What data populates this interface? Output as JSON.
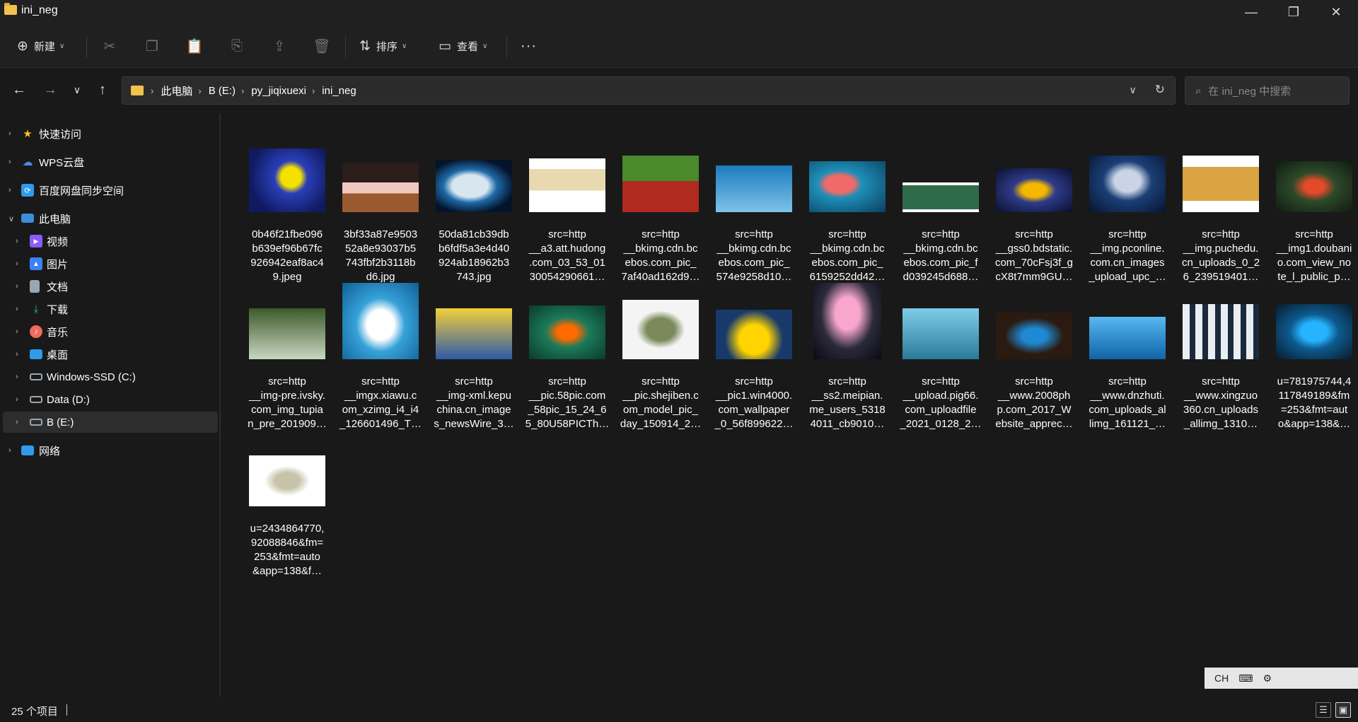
{
  "window": {
    "title": "ini_neg",
    "min": "—",
    "max": "❐",
    "close": "✕"
  },
  "toolbar": {
    "new_label": "新建",
    "sort_label": "排序",
    "view_label": "查看",
    "more_label": "···"
  },
  "breadcrumb": [
    "此电脑",
    "B (E:)",
    "py_jiqixuexi",
    "ini_neg"
  ],
  "search": {
    "placeholder": "在 ini_neg 中搜索"
  },
  "sidebar": {
    "items": [
      {
        "label": "快速访问",
        "icon": "star-icon",
        "color": "#f5c518"
      },
      {
        "label": "WPS云盘",
        "icon": "cloud-icon",
        "color": "#4a8fe7"
      },
      {
        "label": "百度网盘同步空间",
        "icon": "sync-icon",
        "color": "#2f9bea"
      },
      {
        "label": "此电脑",
        "icon": "computer-icon",
        "color": "#3b8edb"
      },
      {
        "label": "视频",
        "icon": "video-icon",
        "color": "#8b5cf6"
      },
      {
        "label": "图片",
        "icon": "picture-icon",
        "color": "#3b82f6"
      },
      {
        "label": "文档",
        "icon": "document-icon",
        "color": "#9aa6b2"
      },
      {
        "label": "下载",
        "icon": "download-icon",
        "color": "#22c55e"
      },
      {
        "label": "音乐",
        "icon": "music-icon",
        "color": "#ef6a5a"
      },
      {
        "label": "桌面",
        "icon": "desktop-icon",
        "color": "#2f9bea"
      },
      {
        "label": "Windows-SSD (C:)",
        "icon": "drive-icon",
        "color": "#9aa6b2"
      },
      {
        "label": "Data (D:)",
        "icon": "drive-icon",
        "color": "#9aa6b2"
      },
      {
        "label": "B (E:)",
        "icon": "drive-icon",
        "color": "#9aa6b2"
      },
      {
        "label": "网络",
        "icon": "network-icon",
        "color": "#2f9bea"
      }
    ]
  },
  "files": [
    {
      "name": "0b46f21fbe096b639ef96b67fc926942eaf8ac49.jpeg",
      "lines": [
        "0b46f21fbe096",
        "b639ef96b67fc",
        "926942eaf8ac4",
        "9.jpeg"
      ]
    },
    {
      "name": "3bf33a87e950352a8e93037b5743fbf2b3118bd6.jpg",
      "lines": [
        "3bf33a87e9503",
        "52a8e93037b5",
        "743fbf2b3118b",
        "d6.jpg"
      ]
    },
    {
      "name": "50da81cb39dbb6fdf5a3e4d40924ab18962b3743.jpg",
      "lines": [
        "50da81cb39db",
        "b6fdf5a3e4d40",
        "924ab18962b3",
        "743.jpg"
      ]
    },
    {
      "name": "src=http__a3.att.hudong.com_03_53_0130054290661…",
      "lines": [
        "src=http",
        "__a3.att.hudong",
        ".com_03_53_01",
        "30054290661…"
      ]
    },
    {
      "name": "src=http__bkimg.cdn.bcebos.com_pic_7af40ad162d9…",
      "lines": [
        "src=http",
        "__bkimg.cdn.bc",
        "ebos.com_pic_",
        "7af40ad162d9…"
      ]
    },
    {
      "name": "src=http__bkimg.cdn.bcebos.com_pic_574e9258d10…",
      "lines": [
        "src=http",
        "__bkimg.cdn.bc",
        "ebos.com_pic_",
        "574e9258d10…"
      ]
    },
    {
      "name": "src=http__bkimg.cdn.bcebos.com_pic_6159252dd42…",
      "lines": [
        "src=http",
        "__bkimg.cdn.bc",
        "ebos.com_pic_",
        "6159252dd42…"
      ]
    },
    {
      "name": "src=http__bkimg.cdn.bcebos.com_pic_fd039245d688…",
      "lines": [
        "src=http",
        "__bkimg.cdn.bc",
        "ebos.com_pic_f",
        "d039245d688…"
      ]
    },
    {
      "name": "src=http__gss0.bdstatic.com_70cFsj3f_gcX8t7mm9GU…",
      "lines": [
        "src=http",
        "__gss0.bdstatic.",
        "com_70cFsj3f_g",
        "cX8t7mm9GU…"
      ]
    },
    {
      "name": "src=http__img.pconline.com.cn_images_upload_upc_…",
      "lines": [
        "src=http",
        "__img.pconline.",
        "com.cn_images",
        "_upload_upc_…"
      ]
    },
    {
      "name": "src=http__img.puchedu.cn_uploads_0_26_239519401…",
      "lines": [
        "src=http",
        "__img.puchedu.",
        "cn_uploads_0_2",
        "6_239519401…"
      ]
    },
    {
      "name": "src=http__img1.doubanio.com_view_note_l_public_p…",
      "lines": [
        "src=http",
        "__img1.doubani",
        "o.com_view_no",
        "te_l_public_p…"
      ]
    },
    {
      "name": "src=http__img-pre.ivsky.com_img_tupian_pre_201909…",
      "lines": [
        "src=http",
        "__img-pre.ivsky.",
        "com_img_tupia",
        "n_pre_201909…"
      ]
    },
    {
      "name": "src=http__imgx.xiawu.com_xzimg_i4_i4_126601496_T…",
      "lines": [
        "src=http",
        "__imgx.xiawu.c",
        "om_xzimg_i4_i4",
        "_126601496_T…"
      ]
    },
    {
      "name": "src=http__img-xml.kepuchina.cn_images_newsWire_3…",
      "lines": [
        "src=http",
        "__img-xml.kepu",
        "china.cn_image",
        "s_newsWire_3…"
      ]
    },
    {
      "name": "src=http__pic.58pic.com_58pic_15_24_65_80U58PICTh…",
      "lines": [
        "src=http",
        "__pic.58pic.com",
        "_58pic_15_24_6",
        "5_80U58PICTh…"
      ]
    },
    {
      "name": "src=http__pic.shejiben.com_model_pic_day_150914_2…",
      "lines": [
        "src=http",
        "__pic.shejiben.c",
        "om_model_pic_",
        "day_150914_2…"
      ]
    },
    {
      "name": "src=http__pic1.win4000.com_wallpaper_0_56f899622…",
      "lines": [
        "src=http",
        "__pic1.win4000.",
        "com_wallpaper",
        "_0_56f899622…"
      ]
    },
    {
      "name": "src=http__ss2.meipian.me_users_53184011_cb9010…",
      "lines": [
        "src=http",
        "__ss2.meipian.",
        "me_users_5318",
        "4011_cb9010…"
      ]
    },
    {
      "name": "src=http__upload.pig66.com_uploadfile_2021_0128_2…",
      "lines": [
        "src=http",
        "__upload.pig66.",
        "com_uploadfile",
        "_2021_0128_2…"
      ]
    },
    {
      "name": "src=http__www.2008php.com_2017_Website_apprec…",
      "lines": [
        "src=http",
        "__www.2008ph",
        "p.com_2017_W",
        "ebsite_apprec…"
      ]
    },
    {
      "name": "src=http__www.dnzhuti.com_uploads_allimg_161121_…",
      "lines": [
        "src=http",
        "__www.dnzhuti.",
        "com_uploads_al",
        "limg_161121_…"
      ]
    },
    {
      "name": "src=http__www.xingzuo360.cn_uploads_allimg_1310…",
      "lines": [
        "src=http",
        "__www.xingzuo",
        "360.cn_uploads",
        "_allimg_1310…"
      ]
    },
    {
      "name": "u=781975744,4117849189&fm=253&fmt=auto&app=138&…",
      "lines": [
        "u=781975744,4",
        "117849189&fm",
        "=253&fmt=aut",
        "o&app=138&…"
      ]
    },
    {
      "name": "u=2434864770,92088846&fm=253&fmt=auto&app=138&f…",
      "lines": [
        "u=2434864770,",
        "92088846&fm=",
        "253&fmt=auto",
        "&app=138&f…"
      ]
    }
  ],
  "status": {
    "count": "25 个项目"
  },
  "ime": {
    "label": "CH"
  }
}
